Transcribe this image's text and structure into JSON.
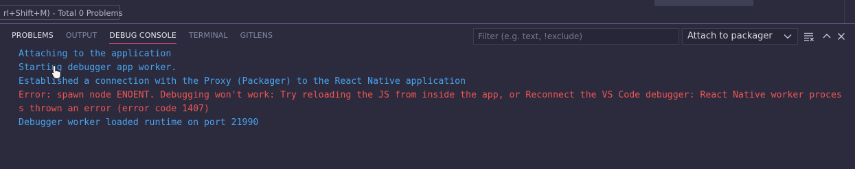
{
  "tooltip": "rl+Shift+M) - Total 0 Problems",
  "tabs": [
    {
      "label": "PROBLEMS"
    },
    {
      "label": "OUTPUT"
    },
    {
      "label": "DEBUG CONSOLE"
    },
    {
      "label": "TERMINAL"
    },
    {
      "label": "GITLENS"
    }
  ],
  "active_tab": "DEBUG CONSOLE",
  "filter": {
    "placeholder": "Filter (e.g. text, !exclude)",
    "value": ""
  },
  "target_select": {
    "selected": "Attach to packager"
  },
  "icons": {
    "select_chevron": "chevron-down-icon",
    "clear": "clear-console-icon",
    "maximize": "chevron-up-icon",
    "close": "close-icon"
  },
  "colors": {
    "info_text": "#4aa3f0",
    "error_text": "#ef5555",
    "active_tab_underline": "#c94a86",
    "panel_border": "#6c5a9a",
    "background": "#2b2b3d"
  },
  "console": {
    "lines": [
      {
        "type": "info",
        "text": "Attaching to the application"
      },
      {
        "type": "info",
        "text": "Starting debugger app worker."
      },
      {
        "type": "info",
        "text": "Established a connection with the Proxy (Packager) to the React Native application"
      },
      {
        "type": "error",
        "text": "Error: spawn node ENOENT. Debugging won't work: Try reloading the JS from inside the app, or Reconnect the VS Code debugger: React Native worker process thrown an error (error code 1407)"
      },
      {
        "type": "info",
        "text": "Debugger worker loaded runtime on port 21990"
      }
    ]
  }
}
